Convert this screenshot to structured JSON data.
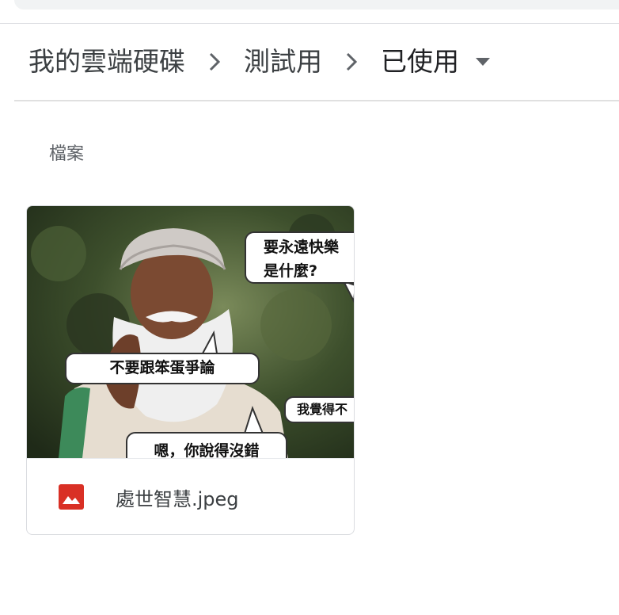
{
  "breadcrumb": {
    "items": [
      {
        "label": "我的雲端硬碟"
      },
      {
        "label": "測試用"
      },
      {
        "label": "已使用"
      }
    ]
  },
  "section": {
    "title": "檔案"
  },
  "file": {
    "name": "處世智慧.jpeg",
    "thumbnail_text": {
      "bubble_top_right": "要永遠快樂\n是什麼?",
      "bubble_left": "不要跟笨蛋爭論",
      "bubble_right": "我覺得不",
      "bubble_bottom": "嗯，你說得沒錯"
    }
  },
  "colors": {
    "image_icon": "#d93025",
    "divider": "#e0e0e0",
    "muted_text": "#5f6368"
  }
}
